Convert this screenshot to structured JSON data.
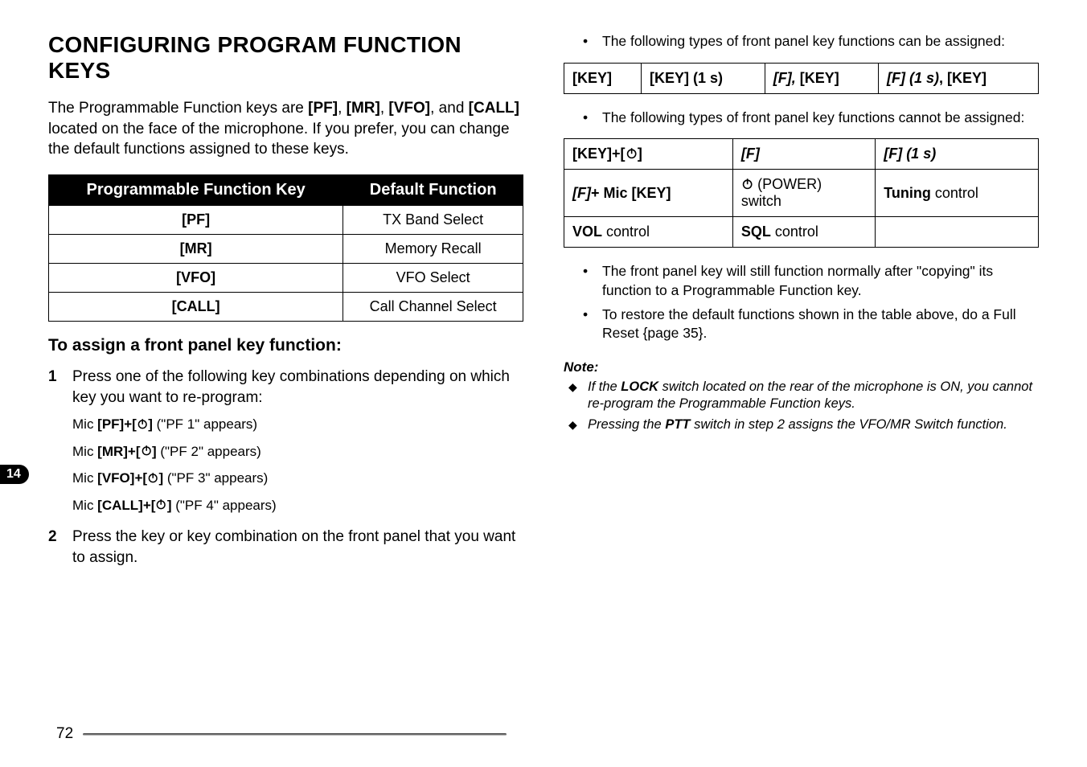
{
  "sideTab": "14",
  "pageNumber": "72",
  "left": {
    "title": "CONFIGURING PROGRAM FUNCTION KEYS",
    "intro_before": "The Programmable Function keys are ",
    "intro_keys": [
      "[PF]",
      "[MR]",
      "[VFO]",
      "[CALL]"
    ],
    "intro_after_a": ", and ",
    "intro_after_b": " located on the face of the microphone.  If you prefer, you can change the default functions assigned to these keys.",
    "table": {
      "headers": [
        "Programmable Function Key",
        "Default Function"
      ],
      "rows": [
        [
          "[PF]",
          "TX Band Select"
        ],
        [
          "[MR]",
          "Memory Recall"
        ],
        [
          "[VFO]",
          "VFO Select"
        ],
        [
          "[CALL]",
          "Call Channel Select"
        ]
      ]
    },
    "subhead": "To assign a front panel key function:",
    "step1": "Press one of the following key combinations depending on which key you want to re-program:",
    "mic_lines": [
      {
        "prefix": "Mic ",
        "key": "[PF]+[",
        "suffix": "]",
        "note": " (\"PF 1\" appears)"
      },
      {
        "prefix": "Mic ",
        "key": "[MR]+[",
        "suffix": "]",
        "note": " (\"PF 2\" appears)"
      },
      {
        "prefix": "Mic ",
        "key": "[VFO]+[",
        "suffix": "]",
        "note": " (\"PF 3\" appears)"
      },
      {
        "prefix": "Mic ",
        "key": "[CALL]+[",
        "suffix": "]",
        "note": " (\"PF 4\" appears)"
      }
    ],
    "step2": "Press the key or key combination on the front panel that you want to assign."
  },
  "right": {
    "bullet_can": "The following types of front panel key functions can be assigned:",
    "can_table": {
      "c1": "[KEY]",
      "c2": "[KEY] (1 s)",
      "c3a": "[F],",
      "c3b": " [KEY]",
      "c4a": "[F] (1 s)",
      "c4b": ", [KEY]"
    },
    "bullet_cannot": "The following types of front panel key functions cannot be assigned:",
    "cannot_table": {
      "r1": {
        "c1_a": "[KEY]+[",
        "c1_b": "]",
        "c2": "[F]",
        "c3": "[F] (1 s)"
      },
      "r2": {
        "c1a": "[F]",
        "c1b": "+ Mic [KEY]",
        "c2a": " (POWER)",
        "c2b": "switch",
        "c3a": "Tuning",
        "c3b": " control"
      },
      "r3": {
        "c1a": "VOL",
        "c1b": " control",
        "c2a": "SQL",
        "c2b": " control",
        "c3": ""
      }
    },
    "bullet_after_1": "The front panel key will still function normally after \"copying\" its function to a Programmable Function key.",
    "bullet_after_2": "To restore the default functions shown in the table above, do a Full Reset {page 35}.",
    "note_label": "Note:",
    "notes": {
      "n1_a": "If the ",
      "n1_b": "LOCK",
      "n1_c": " switch located on the rear of the microphone is ON, you cannot re-program the Programmable Function keys.",
      "n2_a": "Pressing the ",
      "n2_b": "PTT",
      "n2_c": " switch in step 2 assigns the VFO/MR Switch function."
    }
  }
}
